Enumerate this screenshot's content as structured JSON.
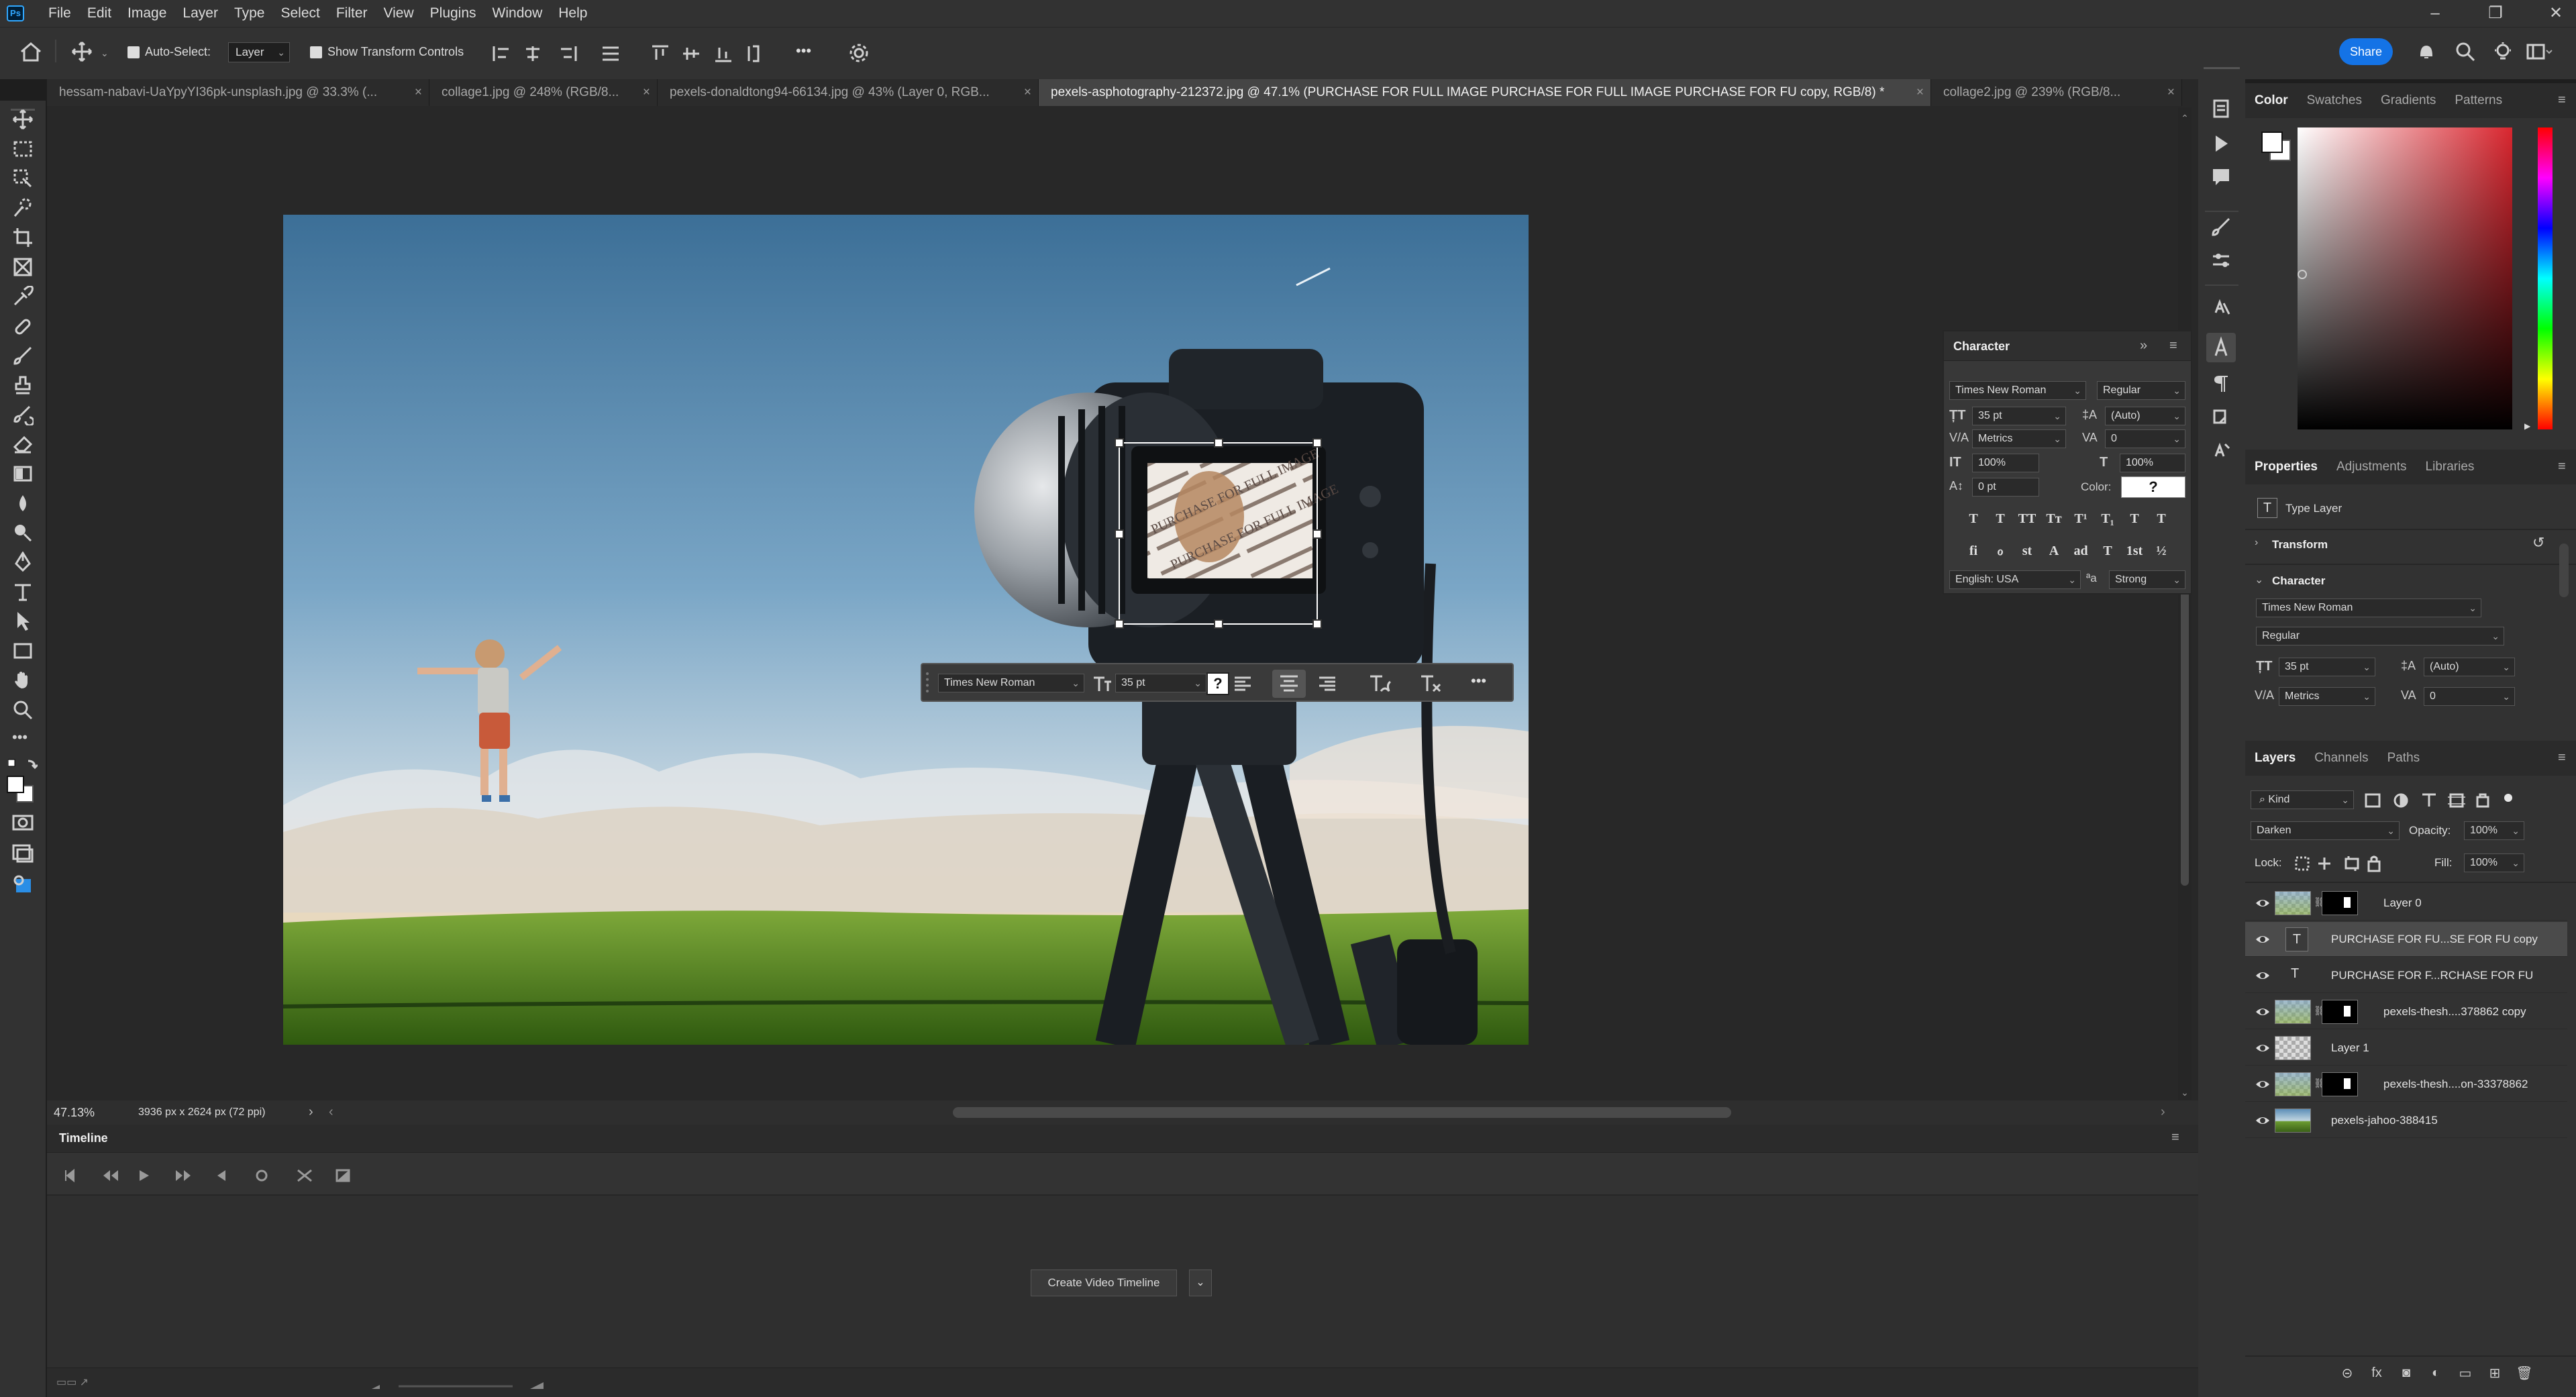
{
  "app": {
    "logo": "Ps"
  },
  "menu": [
    "File",
    "Edit",
    "Image",
    "Layer",
    "Type",
    "Select",
    "Filter",
    "View",
    "Plugins",
    "Window",
    "Help"
  ],
  "window_controls": {
    "minimize": "–",
    "restore": "❐",
    "close": "✕"
  },
  "options": {
    "auto_select_label": "Auto-Select:",
    "auto_select_target": "Layer",
    "transform_controls_label": "Show Transform Controls",
    "share_label": "Share",
    "more": "•••"
  },
  "doc_tabs": [
    {
      "title": "hessam-nabavi-UaYpyYI36pk-unsplash.jpg @ 33.3% (...",
      "close": "×"
    },
    {
      "title": "collage1.jpg @ 248% (RGB/8...",
      "close": "×"
    },
    {
      "title": "pexels-donaldtong94-66134.jpg @ 43% (Layer 0, RGB...",
      "close": "×"
    },
    {
      "title": "pexels-asphotography-212372.jpg @ 47.1% (PURCHASE FOR FULL IMAGE PURCHASE FOR FULL IMAGE PURCHASE FOR FU copy, RGB/8) *",
      "close": "×"
    },
    {
      "title": "collage2.jpg @ 239% (RGB/8...",
      "close": "×"
    }
  ],
  "photo": {
    "colors": {
      "sky_top": "#3c6f97",
      "sky_mid": "#7aa6c6",
      "sky_low": "#c8d8e2",
      "horizon": "#e8d9bf",
      "grass_top": "#7ea93a",
      "grass_bottom": "#2f5a0f",
      "camera": "#1b1f24"
    },
    "watermark_text": "PURCHASE FOR FULL IMAGE"
  },
  "text_toolbar": {
    "font": "Times New Roman",
    "size": "35 pt",
    "more": "•••"
  },
  "character_panel": {
    "title": "Character",
    "font_family": "Times New Roman",
    "font_style": "Regular",
    "size": "35 pt",
    "leading": "(Auto)",
    "kerning": "Metrics",
    "tracking": "0",
    "vertical_scale": "100%",
    "horizontal_scale": "100%",
    "baseline_shift": "0 pt",
    "color_label": "Color:",
    "color_value": "?",
    "language": "English: USA",
    "antialias_icon": "ªa",
    "antialias": "Strong",
    "style_buttons": [
      "T",
      "T",
      "TT",
      "Tт",
      "T¹",
      "T₁",
      "T",
      "T"
    ],
    "opentype_buttons": [
      "fi",
      "ℴ",
      "st",
      "A",
      "ad",
      "T",
      "1st",
      "½"
    ]
  },
  "color_panel": {
    "tabs": [
      "Color",
      "Swatches",
      "Gradients",
      "Patterns"
    ],
    "active_tab": "Color",
    "hue_color": "#d9262f"
  },
  "properties_panel": {
    "tabs": [
      "Properties",
      "Adjustments",
      "Libraries"
    ],
    "active_tab": "Properties",
    "layer_kind": "Type Layer",
    "transform_label": "Transform",
    "character_label": "Character",
    "font_family": "Times New Roman",
    "font_style": "Regular",
    "size": "35 pt",
    "leading": "(Auto)",
    "kerning": "Metrics",
    "tracking": "0"
  },
  "layers_panel": {
    "tabs": [
      "Layers",
      "Channels",
      "Paths"
    ],
    "active_tab": "Layers",
    "filter_kind": "Kind",
    "blend_mode": "Darken",
    "opacity_label": "Opacity:",
    "opacity": "100%",
    "lock_label": "Lock:",
    "fill_label": "Fill:",
    "fill": "100%",
    "layers": [
      {
        "name": "Layer 0",
        "kind": "image-mask",
        "selected": false
      },
      {
        "name": "PURCHASE FOR FU...SE FOR FU copy",
        "kind": "text",
        "selected": true
      },
      {
        "name": "PURCHASE FOR F...RCHASE FOR FU",
        "kind": "text-plain",
        "selected": false
      },
      {
        "name": "pexels-thesh....378862 copy",
        "kind": "image-mask",
        "selected": false
      },
      {
        "name": "Layer 1",
        "kind": "empty",
        "selected": false
      },
      {
        "name": "pexels-thesh....on-33378862",
        "kind": "image-mask",
        "selected": false
      },
      {
        "name": "pexels-jahoo-388415",
        "kind": "image",
        "selected": false
      }
    ],
    "bottom_icons": [
      "⊝",
      "fx",
      "◙",
      "◐",
      "▭",
      "⊞",
      "🗑"
    ]
  },
  "status": {
    "zoom": "47.13%",
    "doc_info": "3936 px x 2624 px (72 ppi)",
    "arrow": "›",
    "arrow_left": "‹"
  },
  "timeline": {
    "title": "Timeline",
    "create_label": "Create Video Timeline"
  }
}
